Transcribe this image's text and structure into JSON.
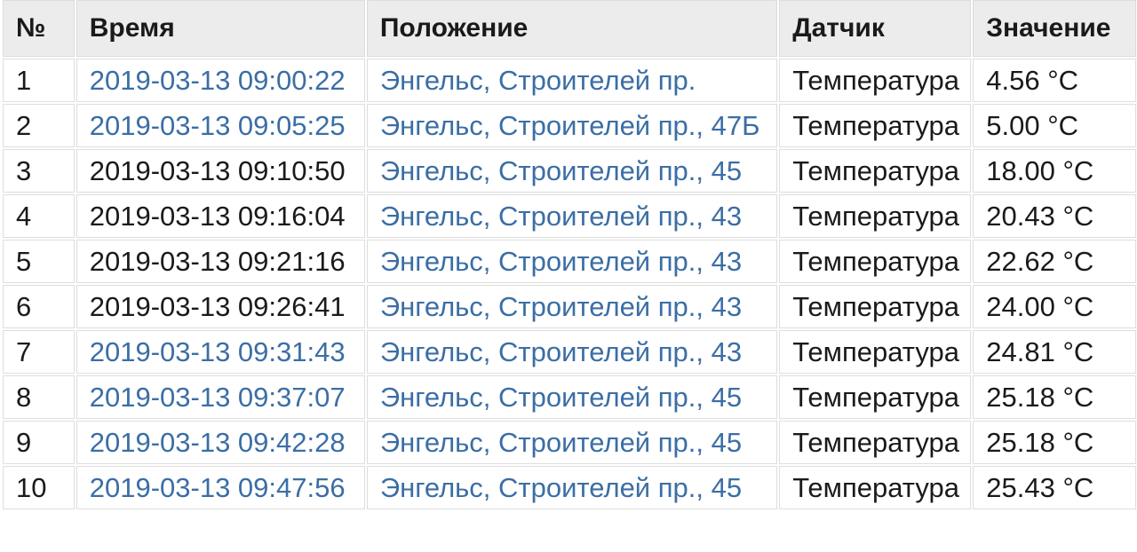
{
  "table": {
    "headers": [
      "№",
      "Время",
      "Положение",
      "Датчик",
      "Значение"
    ],
    "rows": [
      {
        "num": "1",
        "time": "2019-03-13 09:00:22",
        "time_link": true,
        "location": "Энгельс, Строителей пр.",
        "sensor": "Температура",
        "value": "4.56 °C"
      },
      {
        "num": "2",
        "time": "2019-03-13 09:05:25",
        "time_link": true,
        "location": "Энгельс, Строителей пр., 47Б",
        "sensor": "Температура",
        "value": "5.00 °C"
      },
      {
        "num": "3",
        "time": "2019-03-13 09:10:50",
        "time_link": false,
        "location": "Энгельс, Строителей пр., 45",
        "sensor": "Температура",
        "value": "18.00 °C"
      },
      {
        "num": "4",
        "time": "2019-03-13 09:16:04",
        "time_link": false,
        "location": "Энгельс, Строителей пр., 43",
        "sensor": "Температура",
        "value": "20.43 °C"
      },
      {
        "num": "5",
        "time": "2019-03-13 09:21:16",
        "time_link": false,
        "location": "Энгельс, Строителей пр., 43",
        "sensor": "Температура",
        "value": "22.62 °C"
      },
      {
        "num": "6",
        "time": "2019-03-13 09:26:41",
        "time_link": false,
        "location": "Энгельс, Строителей пр., 43",
        "sensor": "Температура",
        "value": "24.00 °C"
      },
      {
        "num": "7",
        "time": "2019-03-13 09:31:43",
        "time_link": true,
        "location": "Энгельс, Строителей пр., 43",
        "sensor": "Температура",
        "value": "24.81 °C"
      },
      {
        "num": "8",
        "time": "2019-03-13 09:37:07",
        "time_link": true,
        "location": "Энгельс, Строителей пр., 45",
        "sensor": "Температура",
        "value": "25.18 °C"
      },
      {
        "num": "9",
        "time": "2019-03-13 09:42:28",
        "time_link": true,
        "location": "Энгельс, Строителей пр., 45",
        "sensor": "Температура",
        "value": "25.18 °C"
      },
      {
        "num": "10",
        "time": "2019-03-13 09:47:56",
        "time_link": true,
        "location": "Энгельс, Строителей пр., 45",
        "sensor": "Температура",
        "value": "25.43 °C"
      }
    ]
  },
  "colors": {
    "link": "#3b6ea5",
    "text": "#1a1a1a",
    "header_bg": "#ececec"
  }
}
